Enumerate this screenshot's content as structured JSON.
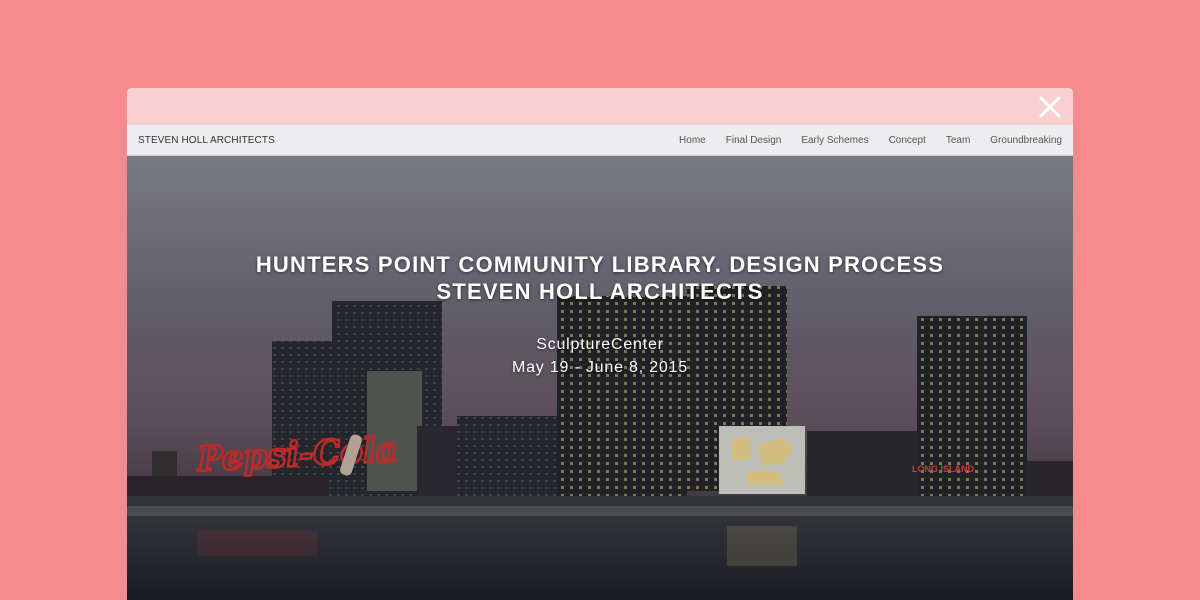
{
  "window": {
    "close_icon": "close-icon"
  },
  "navbar": {
    "brand": "STEVEN HOLL ARCHITECTS",
    "links": [
      "Home",
      "Final Design",
      "Early Schemes",
      "Concept",
      "Team",
      "Groundbreaking"
    ]
  },
  "hero": {
    "title_line1": "HUNTERS POINT COMMUNITY LIBRARY. DESIGN PROCESS",
    "title_line2": "STEVEN HOLL ARCHITECTS",
    "venue": "SculptureCenter",
    "dates": "May 19 - June 8, 2015",
    "image_signage": [
      "PEPSI-COLA",
      "LONG ISLAND"
    ]
  },
  "colors": {
    "page_background": "#f48b8f",
    "topbar": "#f9cfd2",
    "navbar": "#ededf0"
  }
}
